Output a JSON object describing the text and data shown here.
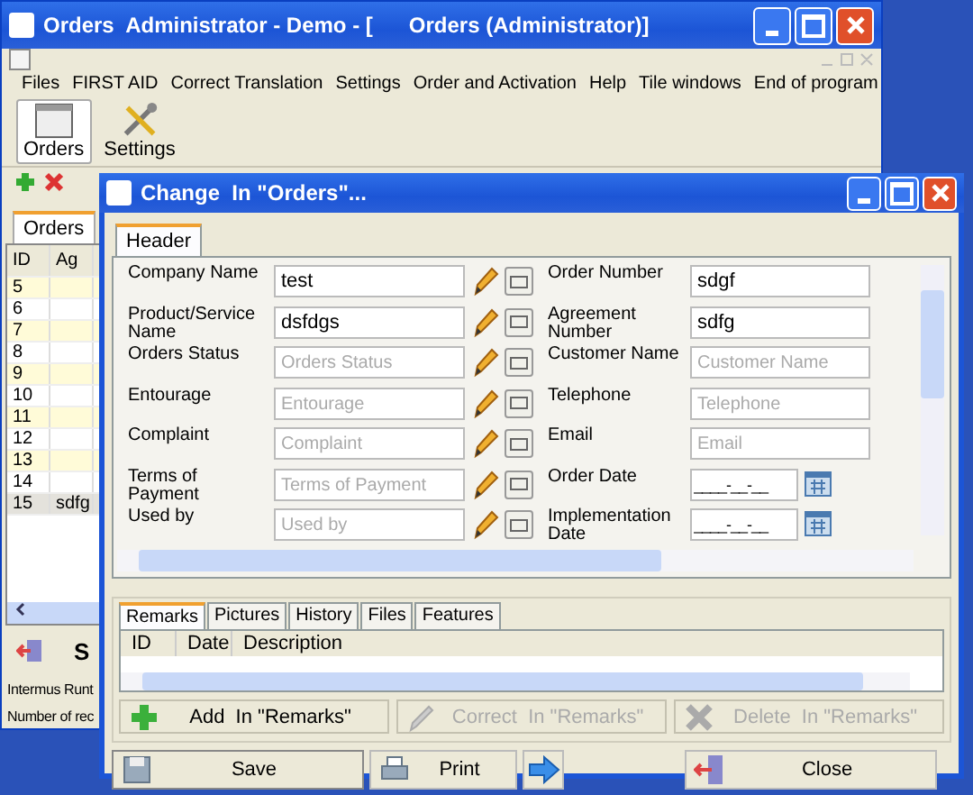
{
  "main_window": {
    "title": "Orders  Administrator - Demo - [      Orders (Administrator)]"
  },
  "menu": [
    "Files",
    "FIRST AID",
    "Correct Translation",
    "Settings",
    "Order and Activation",
    "Help",
    "Tile windows",
    "End of program"
  ],
  "toolbar": [
    {
      "label": "Orders",
      "selected": true,
      "kind": "window"
    },
    {
      "label": "Settings",
      "selected": false,
      "kind": "tools"
    }
  ],
  "list_window": {
    "tab": "Orders",
    "columns": [
      "ID",
      "Ag"
    ],
    "rows": [
      {
        "id": "5",
        "column_2": "",
        "selected": false
      },
      {
        "id": "6",
        "column_2": "",
        "selected": false
      },
      {
        "id": "7",
        "column_2": "",
        "selected": false
      },
      {
        "id": "8",
        "column_2": "",
        "selected": false
      },
      {
        "id": "9",
        "column_2": "",
        "selected": false
      },
      {
        "id": "10",
        "column_2": "",
        "selected": false
      },
      {
        "id": "11",
        "column_2": "",
        "selected": false
      },
      {
        "id": "12",
        "column_2": "",
        "selected": false
      },
      {
        "id": "13",
        "column_2": "",
        "selected": false
      },
      {
        "id": "14",
        "column_2": "",
        "selected": false
      },
      {
        "id": "15",
        "column_2": "sdfg",
        "selected": true
      }
    ],
    "footer_button": "S",
    "status": [
      "Intermus Runt",
      "Number of rec"
    ]
  },
  "dialog": {
    "title": "Change  In \"Orders\"...",
    "tabs": [
      {
        "label": "Header",
        "selected": true
      }
    ],
    "left_fields": [
      {
        "label": "Company Name",
        "value": "test"
      },
      {
        "label": "Product/Service Name",
        "value": "dsfdgs"
      },
      {
        "label": "Orders Status",
        "placeholder": "Orders Status"
      },
      {
        "label": "Entourage",
        "placeholder": "Entourage"
      },
      {
        "label": "Complaint",
        "placeholder": "Complaint"
      },
      {
        "label": "Terms of Payment",
        "placeholder": "Terms of Payment"
      },
      {
        "label": "Used by",
        "placeholder": "Used by"
      }
    ],
    "right_fields": [
      {
        "label": "Order Number",
        "kind": "text",
        "value": "sdgf"
      },
      {
        "label": "Agreement Number",
        "kind": "text",
        "value": "sdfg"
      },
      {
        "label": "Customer Name",
        "kind": "text",
        "placeholder": "Customer Name"
      },
      {
        "label": "Telephone",
        "kind": "text",
        "placeholder": "Telephone"
      },
      {
        "label": "Email",
        "kind": "text",
        "placeholder": "Email"
      },
      {
        "label": "Order Date",
        "kind": "date",
        "value": "____-__-__"
      },
      {
        "label": "Implementation Date",
        "kind": "date",
        "value": "____-__-__"
      }
    ],
    "detail_tabs": [
      {
        "label": "Remarks",
        "selected": true
      },
      {
        "label": "Pictures",
        "selected": false
      },
      {
        "label": "History",
        "selected": false
      },
      {
        "label": "Files",
        "selected": false
      },
      {
        "label": "Features",
        "selected": false
      }
    ],
    "detail_columns": [
      "ID",
      "Date",
      "Description"
    ],
    "detail_actions": [
      {
        "kind": "add",
        "label": "Add  In \"Remarks\"",
        "disabled": false
      },
      {
        "kind": "correct",
        "label": "Correct  In \"Remarks\"",
        "disabled": true
      },
      {
        "kind": "delete",
        "label": "Delete  In \"Remarks\"",
        "disabled": true
      }
    ],
    "buttons": [
      {
        "kind": "save",
        "label": "Save"
      },
      {
        "kind": "print",
        "label": "Print"
      },
      {
        "kind": "next"
      },
      {
        "kind": "close",
        "label": "Close"
      }
    ]
  }
}
